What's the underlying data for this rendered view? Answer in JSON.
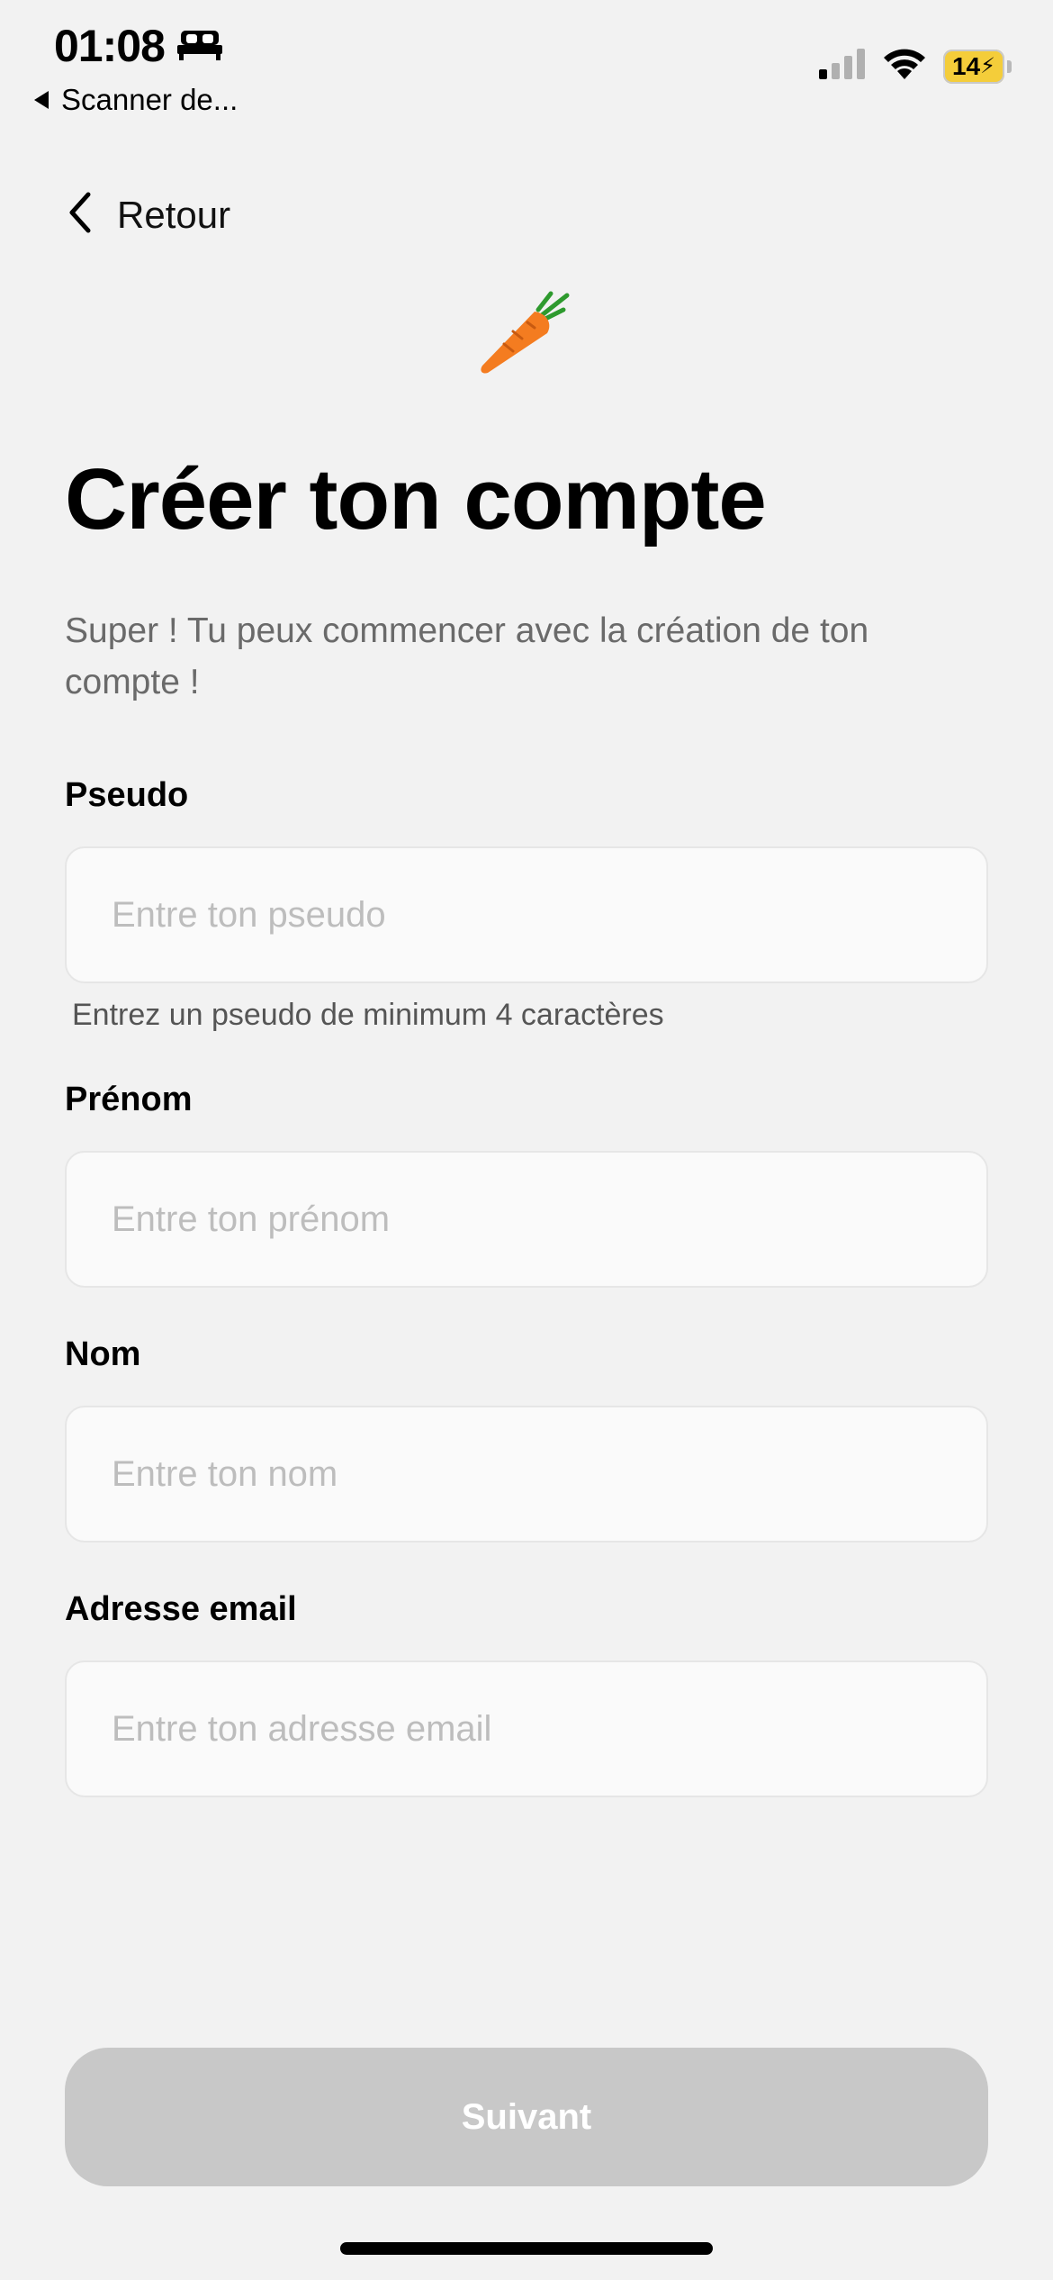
{
  "status_bar": {
    "time": "01:08",
    "back_app": "Scanner de...",
    "battery": "14"
  },
  "nav": {
    "back_label": "Retour"
  },
  "header": {
    "title": "Créer ton compte",
    "subtitle": "Super ! Tu peux commencer avec la création de ton compte !"
  },
  "form": {
    "pseudo": {
      "label": "Pseudo",
      "value": "",
      "placeholder": "Entre ton pseudo",
      "hint": "Entrez un pseudo de minimum 4 caractères"
    },
    "prenom": {
      "label": "Prénom",
      "value": "",
      "placeholder": "Entre ton prénom"
    },
    "nom": {
      "label": "Nom",
      "value": "",
      "placeholder": "Entre ton nom"
    },
    "email": {
      "label": "Adresse email",
      "value": "",
      "placeholder": "Entre ton adresse email"
    }
  },
  "footer": {
    "next_label": "Suivant"
  },
  "colors": {
    "background": "#f2f2f2",
    "button_disabled": "#c8c8c8",
    "carrot": "#f47c20",
    "carrot_leaf": "#2e9a2e",
    "battery": "#f4cd3a"
  }
}
